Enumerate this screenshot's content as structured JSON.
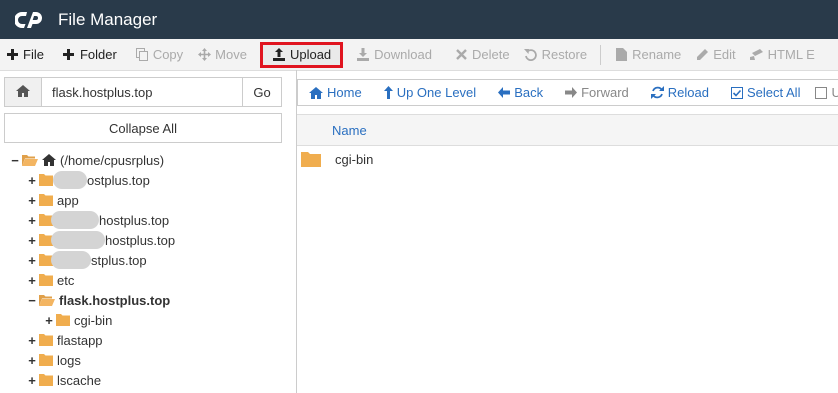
{
  "app": {
    "title": "File Manager"
  },
  "colors": {
    "topbar": "#293a4a",
    "accent": "#2a6fc0",
    "highlight": "#e0141f",
    "folder": "#f0ad4e"
  },
  "toolbar": [
    {
      "label": "File",
      "icon": "plus-icon",
      "enabled": true
    },
    {
      "label": "Folder",
      "icon": "plus-icon",
      "enabled": true
    },
    {
      "label": "Copy",
      "icon": "copy-icon",
      "enabled": false
    },
    {
      "label": "Move",
      "icon": "move-icon",
      "enabled": false
    },
    {
      "label": "Upload",
      "icon": "upload-icon",
      "enabled": true,
      "highlighted": true
    },
    {
      "label": "Download",
      "icon": "download-icon",
      "enabled": false
    },
    {
      "label": "Delete",
      "icon": "delete-icon",
      "enabled": false
    },
    {
      "label": "Restore",
      "icon": "restore-icon",
      "enabled": false
    },
    {
      "label": "Rename",
      "icon": "rename-icon",
      "enabled": false
    },
    {
      "label": "Edit",
      "icon": "edit-icon",
      "enabled": false
    },
    {
      "label": "HTML E",
      "icon": "html-editor-icon",
      "enabled": false
    }
  ],
  "left": {
    "path_value": "flask.hostplus.top",
    "go_label": "Go",
    "collapse_label": "Collapse All"
  },
  "tree": [
    {
      "label": "(/home/cpusrplus)",
      "level": 0,
      "toggle": "−",
      "open": true,
      "home": true
    },
    {
      "label": "ostplus.top",
      "level": 1,
      "toggle": "+",
      "redacted": true
    },
    {
      "label": "app",
      "level": 1,
      "toggle": "+"
    },
    {
      "label": "hostplus.top",
      "level": 1,
      "toggle": "+",
      "redacted": true
    },
    {
      "label": "hostplus.top",
      "level": 1,
      "toggle": "+",
      "redacted": true
    },
    {
      "label": "stplus.top",
      "level": 1,
      "toggle": "+",
      "redacted": true
    },
    {
      "label": "etc",
      "level": 1,
      "toggle": "+"
    },
    {
      "label": "flask.hostplus.top",
      "level": 1,
      "toggle": "−",
      "open": true,
      "bold": true
    },
    {
      "label": "cgi-bin",
      "level": 2,
      "toggle": "+"
    },
    {
      "label": "flastapp",
      "level": 1,
      "toggle": "+"
    },
    {
      "label": "logs",
      "level": 1,
      "toggle": "+"
    },
    {
      "label": "lscache",
      "level": 1,
      "toggle": "+"
    }
  ],
  "nav": [
    {
      "label": "Home",
      "icon": "home-icon",
      "enabled": true
    },
    {
      "label": "Up One Level",
      "icon": "up-level-icon",
      "enabled": true
    },
    {
      "label": "Back",
      "icon": "back-arrow-icon",
      "enabled": true
    },
    {
      "label": "Forward",
      "icon": "forward-arrow-icon",
      "enabled": false
    },
    {
      "label": "Reload",
      "icon": "reload-icon",
      "enabled": true
    },
    {
      "label": "Select All",
      "icon": "check-square-icon",
      "enabled": true
    },
    {
      "label": "U",
      "icon": "checkbox-icon",
      "enabled": true
    }
  ],
  "list": {
    "header": "Name",
    "rows": [
      {
        "name": "cgi-bin",
        "type": "folder"
      }
    ]
  }
}
